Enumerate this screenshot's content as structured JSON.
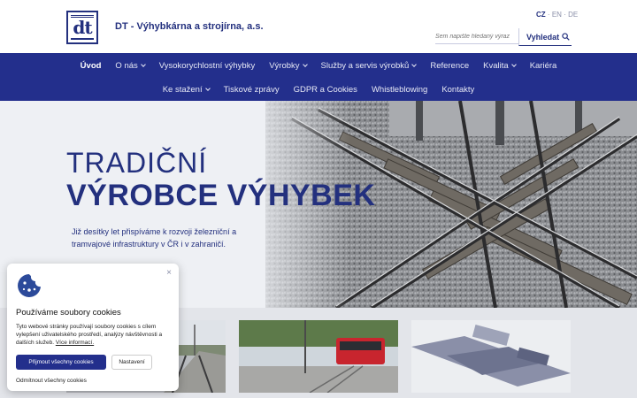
{
  "header": {
    "logo_alt": "dt",
    "company_name": "DT - Výhybkárna a strojírna, a.s.",
    "languages": [
      "CZ",
      "EN",
      "DE"
    ],
    "active_language": "CZ",
    "search": {
      "placeholder": "Sem napište hledaný výraz",
      "button_label": "Vyhledat"
    }
  },
  "nav": {
    "row1": [
      {
        "label": "Úvod",
        "active": true,
        "dropdown": false
      },
      {
        "label": "O nás",
        "active": false,
        "dropdown": true
      },
      {
        "label": "Vysokorychlostní výhybky",
        "active": false,
        "dropdown": false
      },
      {
        "label": "Výrobky",
        "active": false,
        "dropdown": true
      },
      {
        "label": "Služby a servis výrobků",
        "active": false,
        "dropdown": true
      },
      {
        "label": "Reference",
        "active": false,
        "dropdown": false
      },
      {
        "label": "Kvalita",
        "active": false,
        "dropdown": true
      },
      {
        "label": "Kariéra",
        "active": false,
        "dropdown": false
      }
    ],
    "row2": [
      {
        "label": "Ke stažení",
        "active": false,
        "dropdown": true
      },
      {
        "label": "Tiskové zprávy",
        "active": false,
        "dropdown": false
      },
      {
        "label": "GDPR a Cookies",
        "active": false,
        "dropdown": false
      },
      {
        "label": "Whistleblowing",
        "active": false,
        "dropdown": false
      },
      {
        "label": "Kontakty",
        "active": false,
        "dropdown": false
      }
    ]
  },
  "hero": {
    "title_line1": "TRADIČNÍ",
    "title_line2": "VÝROBCE VÝHYBEK",
    "text": "Již desítky let přispíváme k rozvoji železniční a tramvajové infrastruktury v ČR i v zahraničí."
  },
  "cookie_banner": {
    "title": "Používáme soubory cookies",
    "text": "Tyto webové stránky používají soubory cookies s cílem vylepšení uživatelského prostředí, analýzy návštěvnosti a dalších služeb.",
    "more_link": "Více informací.",
    "accept_all": "Přijmout všechny cookies",
    "settings": "Nastavení",
    "reject_all": "Odmítnout všechny cookies",
    "close_symbol": "×"
  },
  "colors": {
    "brand_blue": "#232f8c",
    "text_blue": "#23307e"
  }
}
